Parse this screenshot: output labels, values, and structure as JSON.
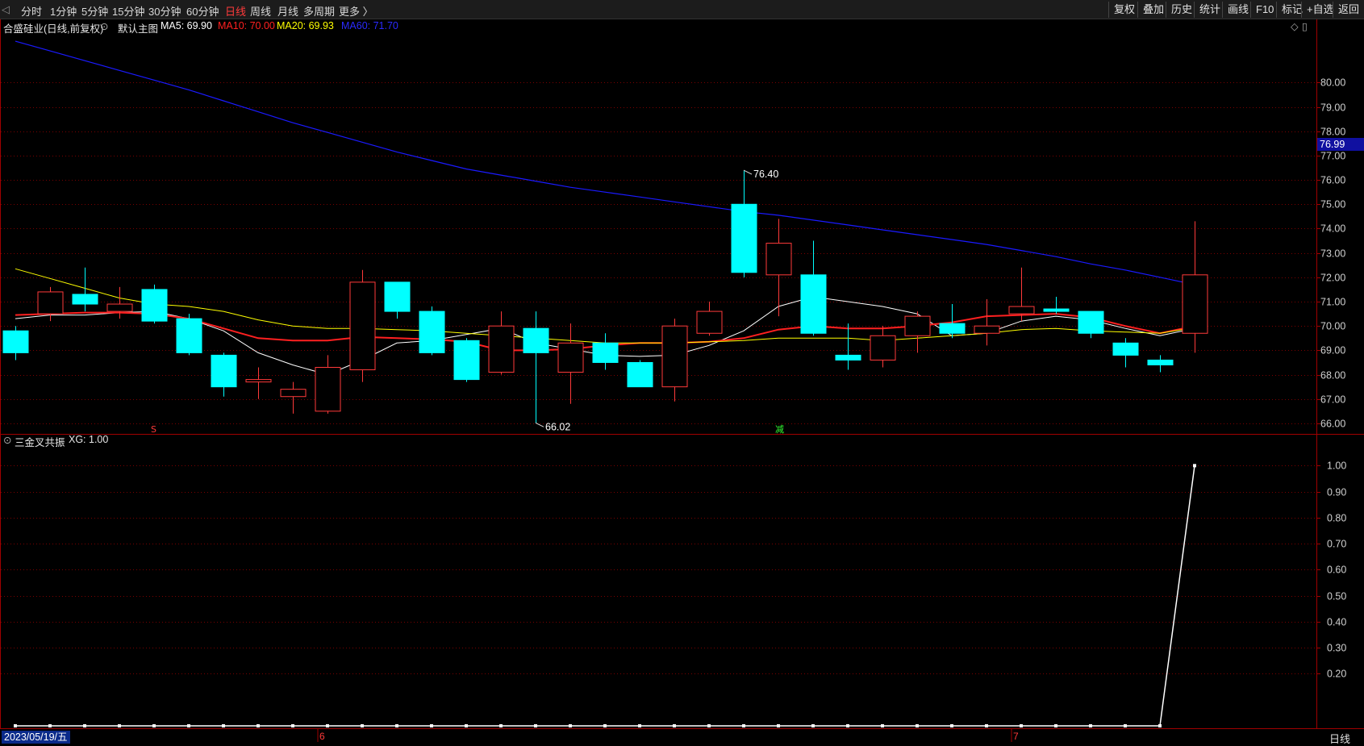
{
  "toolbar": {
    "periods": [
      "分时",
      "1分钟",
      "5分钟",
      "15分钟",
      "30分钟",
      "60分钟",
      "日线",
      "周线",
      "月线",
      "多周期",
      "更多 〉"
    ],
    "active_period": "日线",
    "actions": [
      "复权",
      "叠加",
      "历史",
      "统计",
      "画线",
      "F10",
      "标记",
      "+自选",
      "返回"
    ]
  },
  "info": {
    "stock_title": "合盛硅业(日线,前复权)",
    "template": "默认主图",
    "ma5": "MA5: 69.90",
    "ma10": "MA10: 70.00",
    "ma20": "MA20: 69.93",
    "ma60": "MA60: 71.70"
  },
  "indicator": {
    "name": "三金叉共振",
    "value": "XG: 1.00"
  },
  "current_price_label": "76.99",
  "period_label": "日线",
  "date_label": "2023/05/19/五",
  "colors": {
    "up": "#ff3a3a",
    "down": "#00ffff",
    "ma5": "#ffffff",
    "ma10": "#ff2020",
    "ma20": "#ffff00",
    "ma60": "#1a1aff",
    "grid": "#7a0000",
    "axis_text": "#d0d0d0"
  },
  "chart_data": [
    {
      "type": "candlestick",
      "title": "合盛硅业(日线,前复权)",
      "ylim": [
        65.6,
        82.0
      ],
      "y_ticks": [
        66.0,
        67.0,
        68.0,
        69.0,
        70.0,
        71.0,
        72.0,
        73.0,
        74.0,
        75.0,
        76.0,
        77.0,
        78.0,
        79.0,
        80.0
      ],
      "month_labels": [
        {
          "index": 9,
          "label": "6"
        },
        {
          "index": 29,
          "label": "7"
        }
      ],
      "annotations": [
        {
          "index": 21,
          "label": "76.40",
          "value": 76.4
        },
        {
          "index": 15,
          "label": "66.02",
          "value": 66.02
        }
      ],
      "signals": [
        {
          "index": 4,
          "label": "S",
          "color": "#ff3a3a"
        },
        {
          "index": 22,
          "label": "减",
          "color": "#33ff33"
        }
      ],
      "candles": [
        {
          "o": 69.8,
          "h": 70.0,
          "l": 68.6,
          "c": 68.9
        },
        {
          "o": 70.5,
          "h": 71.6,
          "l": 70.2,
          "c": 71.4
        },
        {
          "o": 71.3,
          "h": 72.4,
          "l": 70.6,
          "c": 70.9
        },
        {
          "o": 70.6,
          "h": 71.6,
          "l": 70.3,
          "c": 70.9
        },
        {
          "o": 71.5,
          "h": 71.7,
          "l": 70.1,
          "c": 70.2
        },
        {
          "o": 70.3,
          "h": 70.5,
          "l": 68.8,
          "c": 68.9
        },
        {
          "o": 68.8,
          "h": 68.9,
          "l": 67.1,
          "c": 67.5
        },
        {
          "o": 67.7,
          "h": 68.3,
          "l": 67.0,
          "c": 67.8
        },
        {
          "o": 67.1,
          "h": 67.7,
          "l": 66.4,
          "c": 67.4
        },
        {
          "o": 66.5,
          "h": 68.8,
          "l": 66.4,
          "c": 68.3
        },
        {
          "o": 68.2,
          "h": 72.3,
          "l": 67.7,
          "c": 71.8
        },
        {
          "o": 71.8,
          "h": 71.8,
          "l": 70.3,
          "c": 70.6
        },
        {
          "o": 70.6,
          "h": 70.8,
          "l": 68.8,
          "c": 68.9
        },
        {
          "o": 69.4,
          "h": 69.5,
          "l": 67.7,
          "c": 67.8
        },
        {
          "o": 68.1,
          "h": 70.6,
          "l": 68.0,
          "c": 70.0
        },
        {
          "o": 69.9,
          "h": 70.6,
          "l": 66.0,
          "c": 68.9
        },
        {
          "o": 68.1,
          "h": 70.1,
          "l": 66.8,
          "c": 69.3
        },
        {
          "o": 69.3,
          "h": 69.7,
          "l": 68.2,
          "c": 68.5
        },
        {
          "o": 68.5,
          "h": 68.6,
          "l": 67.5,
          "c": 67.5
        },
        {
          "o": 67.5,
          "h": 70.3,
          "l": 66.9,
          "c": 70.0
        },
        {
          "o": 69.7,
          "h": 71.0,
          "l": 69.6,
          "c": 70.6
        },
        {
          "o": 75.0,
          "h": 76.4,
          "l": 72.0,
          "c": 72.2
        },
        {
          "o": 72.1,
          "h": 74.4,
          "l": 70.4,
          "c": 73.4
        },
        {
          "o": 72.1,
          "h": 73.5,
          "l": 69.6,
          "c": 69.7
        },
        {
          "o": 68.8,
          "h": 70.1,
          "l": 68.2,
          "c": 68.6
        },
        {
          "o": 68.6,
          "h": 70.0,
          "l": 68.3,
          "c": 69.6
        },
        {
          "o": 69.6,
          "h": 70.6,
          "l": 68.9,
          "c": 70.4
        },
        {
          "o": 70.1,
          "h": 70.9,
          "l": 69.5,
          "c": 69.7
        },
        {
          "o": 69.7,
          "h": 71.1,
          "l": 69.2,
          "c": 70.0
        },
        {
          "o": 70.5,
          "h": 72.4,
          "l": 70.2,
          "c": 70.8
        },
        {
          "o": 70.7,
          "h": 71.2,
          "l": 70.5,
          "c": 70.6
        },
        {
          "o": 70.6,
          "h": 70.6,
          "l": 69.5,
          "c": 69.7
        },
        {
          "o": 69.3,
          "h": 69.5,
          "l": 68.3,
          "c": 68.8
        },
        {
          "o": 68.6,
          "h": 68.8,
          "l": 68.1,
          "c": 68.4
        },
        {
          "o": 69.7,
          "h": 74.3,
          "l": 68.9,
          "c": 72.1
        }
      ],
      "series": [
        {
          "name": "MA5",
          "values": [
            70.3,
            70.45,
            70.45,
            70.55,
            70.6,
            70.3,
            69.8,
            68.9,
            68.4,
            68.0,
            68.6,
            69.3,
            69.4,
            69.65,
            69.9,
            69.3,
            69.05,
            68.8,
            68.75,
            68.8,
            69.2,
            69.8,
            70.8,
            71.2,
            71.0,
            70.8,
            70.5,
            69.6,
            69.7,
            70.2,
            70.4,
            70.25,
            69.9,
            69.6,
            69.9
          ]
        },
        {
          "name": "MA10",
          "values": [
            70.45,
            70.5,
            70.55,
            70.55,
            70.5,
            70.3,
            69.9,
            69.5,
            69.4,
            69.4,
            69.55,
            69.5,
            69.45,
            69.35,
            69.0,
            69.0,
            69.05,
            69.2,
            69.3,
            69.3,
            69.35,
            69.5,
            69.85,
            70.0,
            69.9,
            69.9,
            70.0,
            70.15,
            70.4,
            70.45,
            70.5,
            70.35,
            70.0,
            69.7,
            70.0
          ]
        },
        {
          "name": "MA20",
          "values": [
            72.35,
            71.95,
            71.55,
            71.15,
            70.9,
            70.8,
            70.6,
            70.25,
            70.0,
            69.9,
            69.9,
            69.85,
            69.8,
            69.7,
            69.6,
            69.5,
            69.4,
            69.3,
            69.3,
            69.3,
            69.35,
            69.4,
            69.5,
            69.5,
            69.5,
            69.4,
            69.5,
            69.6,
            69.7,
            69.85,
            69.9,
            69.8,
            69.75,
            69.7,
            69.93
          ]
        },
        {
          "name": "MA60",
          "values": [
            81.7,
            81.3,
            80.9,
            80.5,
            80.1,
            79.7,
            79.25,
            78.8,
            78.35,
            77.95,
            77.55,
            77.15,
            76.8,
            76.45,
            76.2,
            75.95,
            75.7,
            75.5,
            75.3,
            75.1,
            74.9,
            74.7,
            74.55,
            74.35,
            74.15,
            73.95,
            73.75,
            73.55,
            73.35,
            73.1,
            72.85,
            72.55,
            72.3,
            72.0,
            71.7
          ]
        }
      ]
    },
    {
      "type": "line",
      "title": "三金叉共振",
      "ylim": [
        0.0,
        1.06
      ],
      "y_ticks": [
        0.2,
        0.3,
        0.4,
        0.5,
        0.6,
        0.7,
        0.8,
        0.9,
        1.0
      ],
      "series": [
        {
          "name": "XG",
          "values": [
            0,
            0,
            0,
            0,
            0,
            0,
            0,
            0,
            0,
            0,
            0,
            0,
            0,
            0,
            0,
            0,
            0,
            0,
            0,
            0,
            0,
            0,
            0,
            0,
            0,
            0,
            0,
            0,
            0,
            0,
            0,
            0,
            0,
            0,
            1
          ]
        }
      ]
    }
  ]
}
